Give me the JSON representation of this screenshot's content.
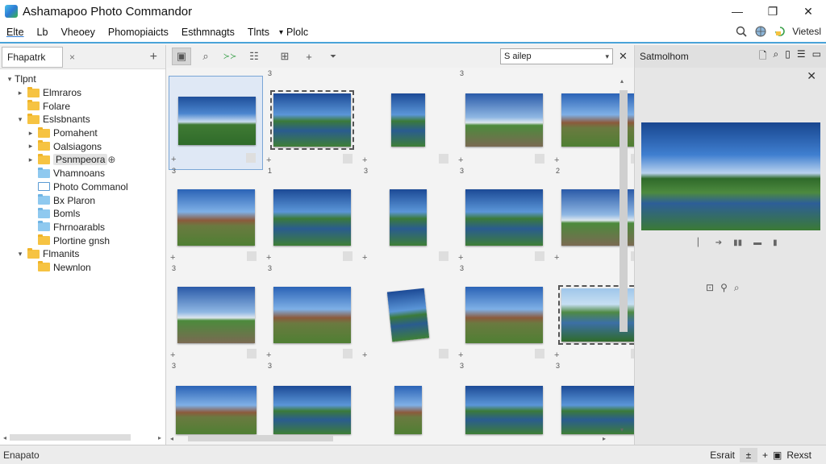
{
  "window": {
    "title": "Ashamapoo Photo Commandor",
    "minimize": "—",
    "maximize": "❐",
    "close": "✕"
  },
  "menu": {
    "items": [
      "Elte",
      "Lb",
      "Vheoey",
      "Phomopiaicts",
      "Esthmnagts",
      "Tlnts",
      "Plolc"
    ],
    "dropdown_glyph": "▾",
    "right_label": "Vietesl"
  },
  "left_panel": {
    "tab_label": "Fhapatrk",
    "tab_close": "×",
    "add": "+",
    "tree": [
      {
        "label": "Tlpnt",
        "level": 0,
        "expander": "▾",
        "icon": "none"
      },
      {
        "label": "Elmraros",
        "level": 1,
        "expander": "▸",
        "icon": "folder"
      },
      {
        "label": "Folare",
        "level": 1,
        "expander": "",
        "icon": "folder"
      },
      {
        "label": "Eslsbnants",
        "level": 1,
        "expander": "▾",
        "icon": "folder"
      },
      {
        "label": "Pomahent",
        "level": 2,
        "expander": "▸",
        "icon": "folder"
      },
      {
        "label": "Oalsiagons",
        "level": 2,
        "expander": "▸",
        "icon": "folder"
      },
      {
        "label": "Psnmpeora",
        "level": 2,
        "expander": "▸",
        "icon": "folder",
        "highlight": true
      },
      {
        "label": "Vhamnoans",
        "level": 2,
        "expander": "",
        "icon": "folder-blue"
      },
      {
        "label": "Photo Commanol",
        "level": 2,
        "expander": "",
        "icon": "doc"
      },
      {
        "label": "Bx Plaron",
        "level": 2,
        "expander": "",
        "icon": "folder-blue"
      },
      {
        "label": "Bomls",
        "level": 2,
        "expander": "",
        "icon": "folder-blue"
      },
      {
        "label": "Fhrnoarabls",
        "level": 2,
        "expander": "",
        "icon": "folder-blue"
      },
      {
        "label": "Plortine gnsh",
        "level": 2,
        "expander": "",
        "icon": "folder"
      },
      {
        "label": "Flmanits",
        "level": 1,
        "expander": "▾",
        "icon": "folder"
      },
      {
        "label": "Newnlon",
        "level": 2,
        "expander": "",
        "icon": "folder"
      }
    ]
  },
  "toolbar": {
    "filter_value": "S ailep",
    "filter_dropdown": "▾",
    "close": "✕",
    "glyphs": [
      "▣",
      "⌕",
      "≻≻",
      "☷",
      "⊞",
      "+",
      "⏷"
    ]
  },
  "grid": {
    "cells": [
      {
        "num": "",
        "style": "landscape",
        "selected": true
      },
      {
        "num": "3",
        "style": "water",
        "frame": true
      },
      {
        "num": "",
        "style": "water"
      },
      {
        "num": "3",
        "style": "sunset"
      },
      {
        "num": "",
        "style": "castle"
      },
      {
        "num": "3",
        "style": "castle"
      },
      {
        "num": "1",
        "style": "water"
      },
      {
        "num": "3",
        "style": "water"
      },
      {
        "num": "3",
        "style": "water"
      },
      {
        "num": "2",
        "style": "sunset"
      },
      {
        "num": "3",
        "style": "sunset"
      },
      {
        "num": "3",
        "style": "castle"
      },
      {
        "num": "",
        "style": "water",
        "tilt": true
      },
      {
        "num": "3",
        "style": "castle"
      },
      {
        "num": "",
        "style": "valley",
        "frame": true
      },
      {
        "num": "3",
        "style": "castle"
      },
      {
        "num": "3",
        "style": "water"
      },
      {
        "num": "",
        "style": "castle"
      },
      {
        "num": "3",
        "style": "water"
      },
      {
        "num": "3",
        "style": "water"
      }
    ],
    "plus": "+"
  },
  "right_panel": {
    "title": "Satmolhom",
    "close": "✕",
    "controls": [
      "▏",
      "➔",
      "▮▮",
      "▬",
      "▮"
    ],
    "tools": [
      "⊡",
      "⚲",
      "⌕"
    ]
  },
  "status": {
    "left": "Enapato",
    "right_label": "Esrait",
    "zoom_glyph": "±",
    "plus": "+",
    "fit_label": "Rexst",
    "fit_glyph": "▣"
  }
}
